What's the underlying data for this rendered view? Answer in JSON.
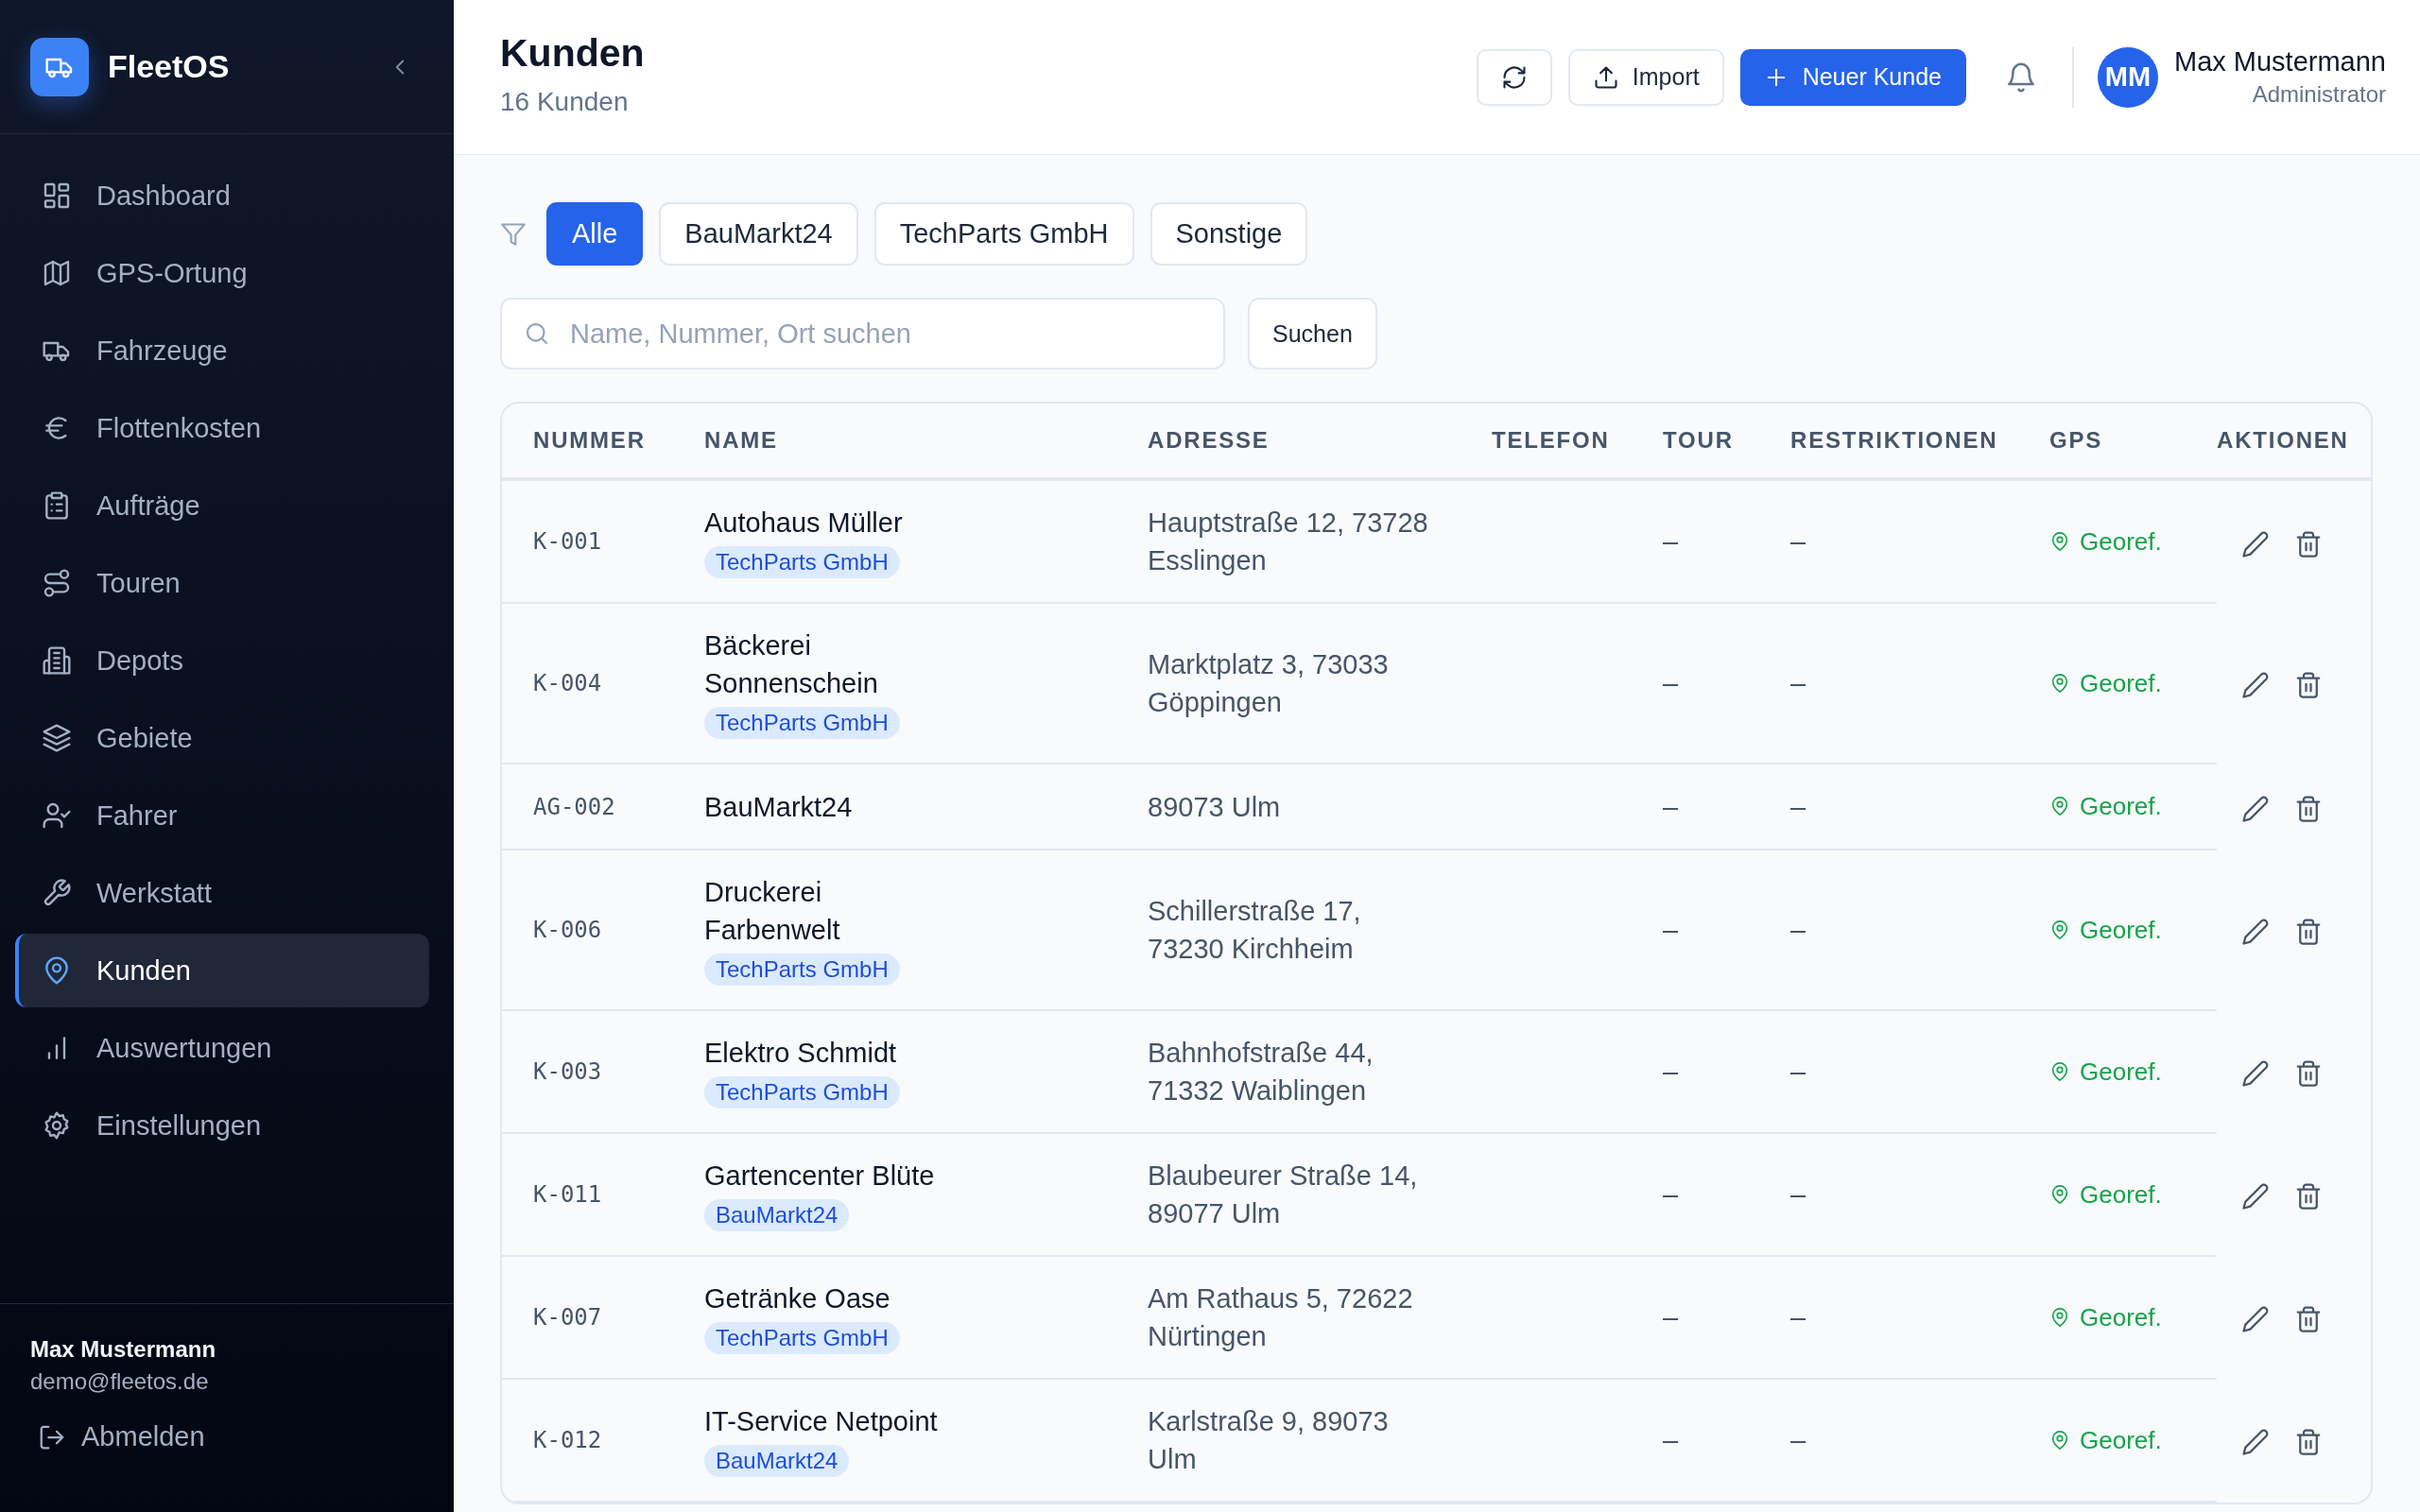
{
  "sidebar": {
    "brand": "FleetOS",
    "items": [
      {
        "label": "Dashboard",
        "selected": false
      },
      {
        "label": "GPS-Ortung",
        "selected": false
      },
      {
        "label": "Fahrzeuge",
        "selected": false
      },
      {
        "label": "Flottenkosten",
        "selected": false
      },
      {
        "label": "Aufträge",
        "selected": false
      },
      {
        "label": "Touren",
        "selected": false
      },
      {
        "label": "Depots",
        "selected": false
      },
      {
        "label": "Gebiete",
        "selected": false
      },
      {
        "label": "Fahrer",
        "selected": false
      },
      {
        "label": "Werkstatt",
        "selected": false
      },
      {
        "label": "Kunden",
        "selected": true
      },
      {
        "label": "Auswertungen",
        "selected": false
      },
      {
        "label": "Einstellungen",
        "selected": false
      }
    ],
    "user": {
      "name": "Max Mustermann",
      "email": "demo@fleetos.de"
    },
    "logout": "Abmelden"
  },
  "header": {
    "title": "Kunden",
    "subtitle": "16 Kunden",
    "import_button": "Import",
    "new_button": "Neuer Kunde",
    "user": {
      "initials": "MM",
      "name": "Max Mustermann",
      "role": "Administrator"
    }
  },
  "filters": [
    {
      "label": "Alle",
      "selected": true
    },
    {
      "label": "BauMarkt24",
      "selected": false
    },
    {
      "label": "TechParts GmbH",
      "selected": false
    },
    {
      "label": "Sonstige",
      "selected": false
    }
  ],
  "search": {
    "placeholder": "Name, Nummer, Ort suchen",
    "button": "Suchen"
  },
  "table": {
    "columns": [
      "NUMMER",
      "NAME",
      "ADRESSE",
      "TELEFON",
      "TOUR",
      "RESTRIKTIONEN",
      "GPS",
      "AKTIONEN"
    ],
    "rows": [
      {
        "number": "K-001",
        "name": "Autohaus Müller",
        "tag": "TechParts GmbH",
        "address": "Hauptstraße 12, 73728 Esslingen",
        "tour": "–",
        "restrictions": "–",
        "gps": "Georef."
      },
      {
        "number": "K-004",
        "name": "Bäckerei Sonnenschein",
        "tag": "TechParts GmbH",
        "address": "Marktplatz 3, 73033 Göppingen",
        "tour": "–",
        "restrictions": "–",
        "gps": "Georef."
      },
      {
        "number": "AG-002",
        "name": "BauMarkt24",
        "address": "89073 Ulm",
        "tour": "–",
        "restrictions": "–",
        "gps": "Georef."
      },
      {
        "number": "K-006",
        "name": "Druckerei Farbenwelt",
        "tag": "TechParts GmbH",
        "address": "Schillerstraße 17, 73230 Kirchheim",
        "tour": "–",
        "restrictions": "–",
        "gps": "Georef."
      },
      {
        "number": "K-003",
        "name": "Elektro Schmidt",
        "tag": "TechParts GmbH",
        "address": "Bahnhofstraße 44, 71332 Waiblingen",
        "tour": "–",
        "restrictions": "–",
        "gps": "Georef."
      },
      {
        "number": "K-011",
        "name": "Gartencenter Blüte",
        "tag": "BauMarkt24",
        "address": "Blaubeurer Straße 14, 89077 Ulm",
        "tour": "–",
        "restrictions": "–",
        "gps": "Georef."
      },
      {
        "number": "K-007",
        "name": "Getränke Oase",
        "tag": "TechParts GmbH",
        "address": "Am Rathaus 5, 72622 Nürtingen",
        "tour": "–",
        "restrictions": "–",
        "gps": "Georef."
      },
      {
        "number": "K-012",
        "name": "IT-Service Netpoint",
        "tag": "BauMarkt24",
        "address": "Karlstraße 9, 89073 Ulm",
        "tour": "–",
        "restrictions": "–",
        "gps": "Georef."
      }
    ]
  }
}
